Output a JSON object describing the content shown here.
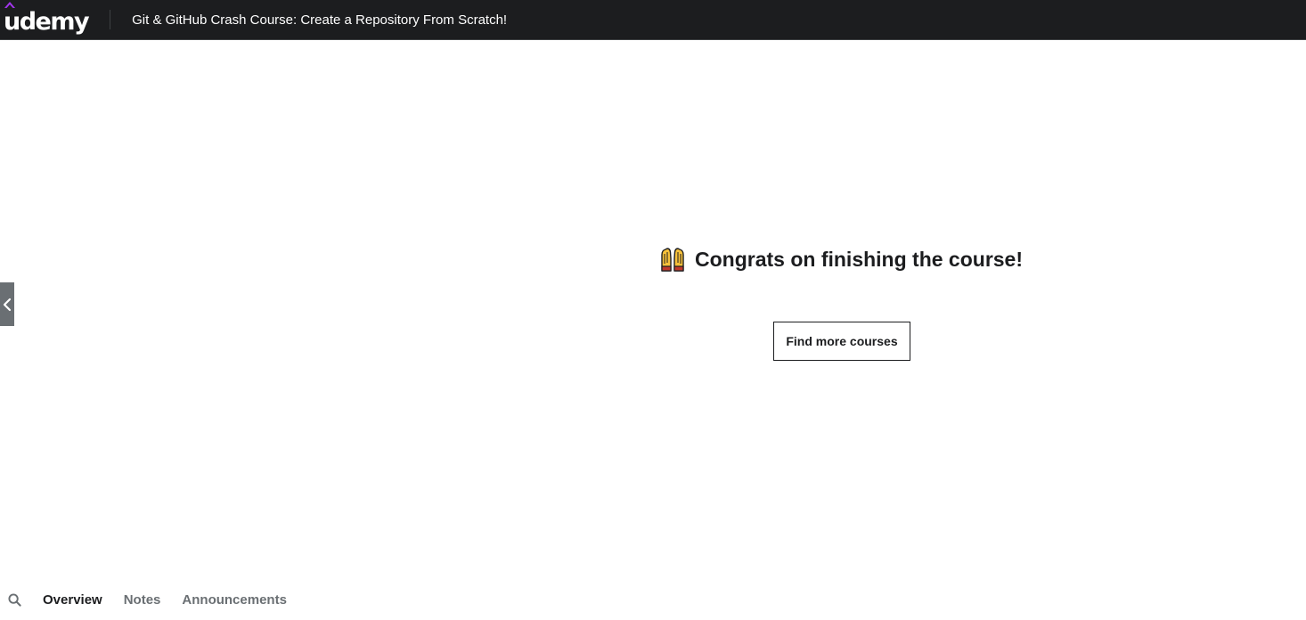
{
  "header": {
    "logo": "udemy",
    "course_title": "Git & GitHub Crash Course: Create a Repository From Scratch!"
  },
  "main": {
    "congrats_emoji": "raised-hands-icon",
    "congrats_message": "Congrats on finishing the course!",
    "find_courses_label": "Find more courses"
  },
  "sidebar_toggle": {
    "icon": "chevron-left-icon"
  },
  "tabs": {
    "search_icon": "search-icon",
    "items": [
      {
        "label": "Overview",
        "active": true
      },
      {
        "label": "Notes",
        "active": false
      },
      {
        "label": "Announcements",
        "active": false
      }
    ]
  },
  "colors": {
    "header_bg": "#1c1d1f",
    "brand_purple": "#a435f0",
    "text_primary": "#1c1d1f",
    "text_muted": "#6a6f73",
    "handle_bg": "#6a6f73",
    "emoji_yellow": "#f7c13a"
  }
}
